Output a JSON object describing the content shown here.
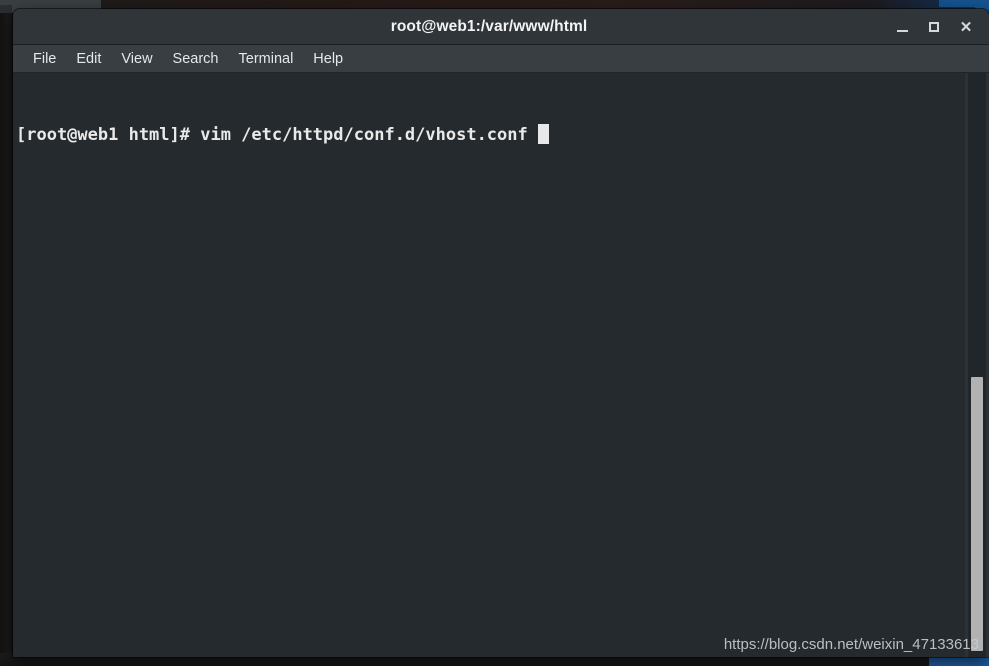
{
  "window": {
    "title": "root@web1:/var/www/html",
    "controls": {
      "minimize_label": "–",
      "maximize_label": "□",
      "close_label": "✕"
    }
  },
  "menubar": {
    "items": [
      {
        "label": "File"
      },
      {
        "label": "Edit"
      },
      {
        "label": "View"
      },
      {
        "label": "Search"
      },
      {
        "label": "Terminal"
      },
      {
        "label": "Help"
      }
    ]
  },
  "terminal": {
    "prompt": "[root@web1 html]# ",
    "command": "vim /etc/httpd/conf.d/vhost.conf ",
    "lines": [
      "[root@web1 html]# vim /etc/httpd/conf.d/vhost.conf "
    ],
    "scrollbar": {
      "thumb_top_percent": "52%",
      "thumb_height_percent": "47%"
    }
  },
  "watermark": {
    "text": "https://blog.csdn.net/weixin_47133613"
  },
  "colors": {
    "titlebar_bg": "#2f3539",
    "menubar_bg": "#383e42",
    "terminal_bg": "#242a2d",
    "terminal_fg": "#e9e9e9",
    "desktop_blue": "#16538f",
    "scrollbar_thumb": "#b2b2b2"
  }
}
